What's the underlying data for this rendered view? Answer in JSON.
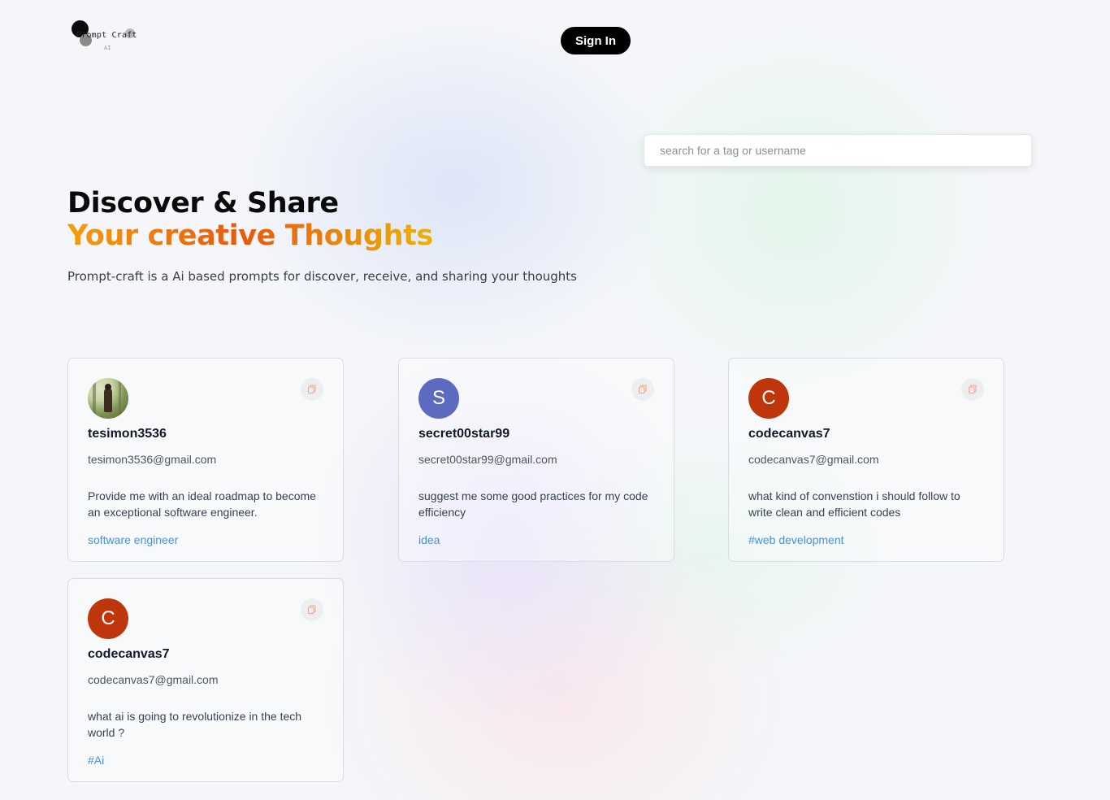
{
  "header": {
    "logo_text": "Prompt Craft",
    "logo_subtext": "AI",
    "signin_label": "Sign In"
  },
  "search": {
    "placeholder": "search for a tag or username",
    "value": ""
  },
  "hero": {
    "title_line1": "Discover & Share",
    "title_line2": "Your creative Thoughts",
    "subtitle": "Prompt-craft is a Ai based prompts for discover, receive, and sharing your thoughts"
  },
  "colors": {
    "gradient": [
      "#f59e0b",
      "#ea580c",
      "#eab308"
    ],
    "tag": "#4b8fd6",
    "avatar_s": "#5c6bc0",
    "avatar_c": "#bf360c"
  },
  "prompts": [
    {
      "avatar": "photo",
      "avatar_letter": "",
      "username": "tesimon3536",
      "email": "tesimon3536@gmail.com",
      "prompt": "Provide me with an ideal roadmap to become an exceptional software engineer.",
      "tag": "software engineer",
      "copy_icon": "copy-icon"
    },
    {
      "avatar": "letter",
      "avatar_letter": "S",
      "username": "secret00star99",
      "email": "secret00star99@gmail.com",
      "prompt": "suggest me some good practices for my code efficiency",
      "tag": "idea",
      "copy_icon": "copy-icon"
    },
    {
      "avatar": "letter",
      "avatar_letter": "C",
      "username": "codecanvas7",
      "email": "codecanvas7@gmail.com",
      "prompt": "what kind of convenstion i should follow to write clean and efficient codes",
      "tag": "#web development",
      "copy_icon": "copy-icon"
    },
    {
      "avatar": "letter",
      "avatar_letter": "C",
      "username": "codecanvas7",
      "email": "codecanvas7@gmail.com",
      "prompt": "what ai is going to revolutionize in the tech world ?",
      "tag": "#Ai",
      "copy_icon": "copy-icon"
    }
  ]
}
